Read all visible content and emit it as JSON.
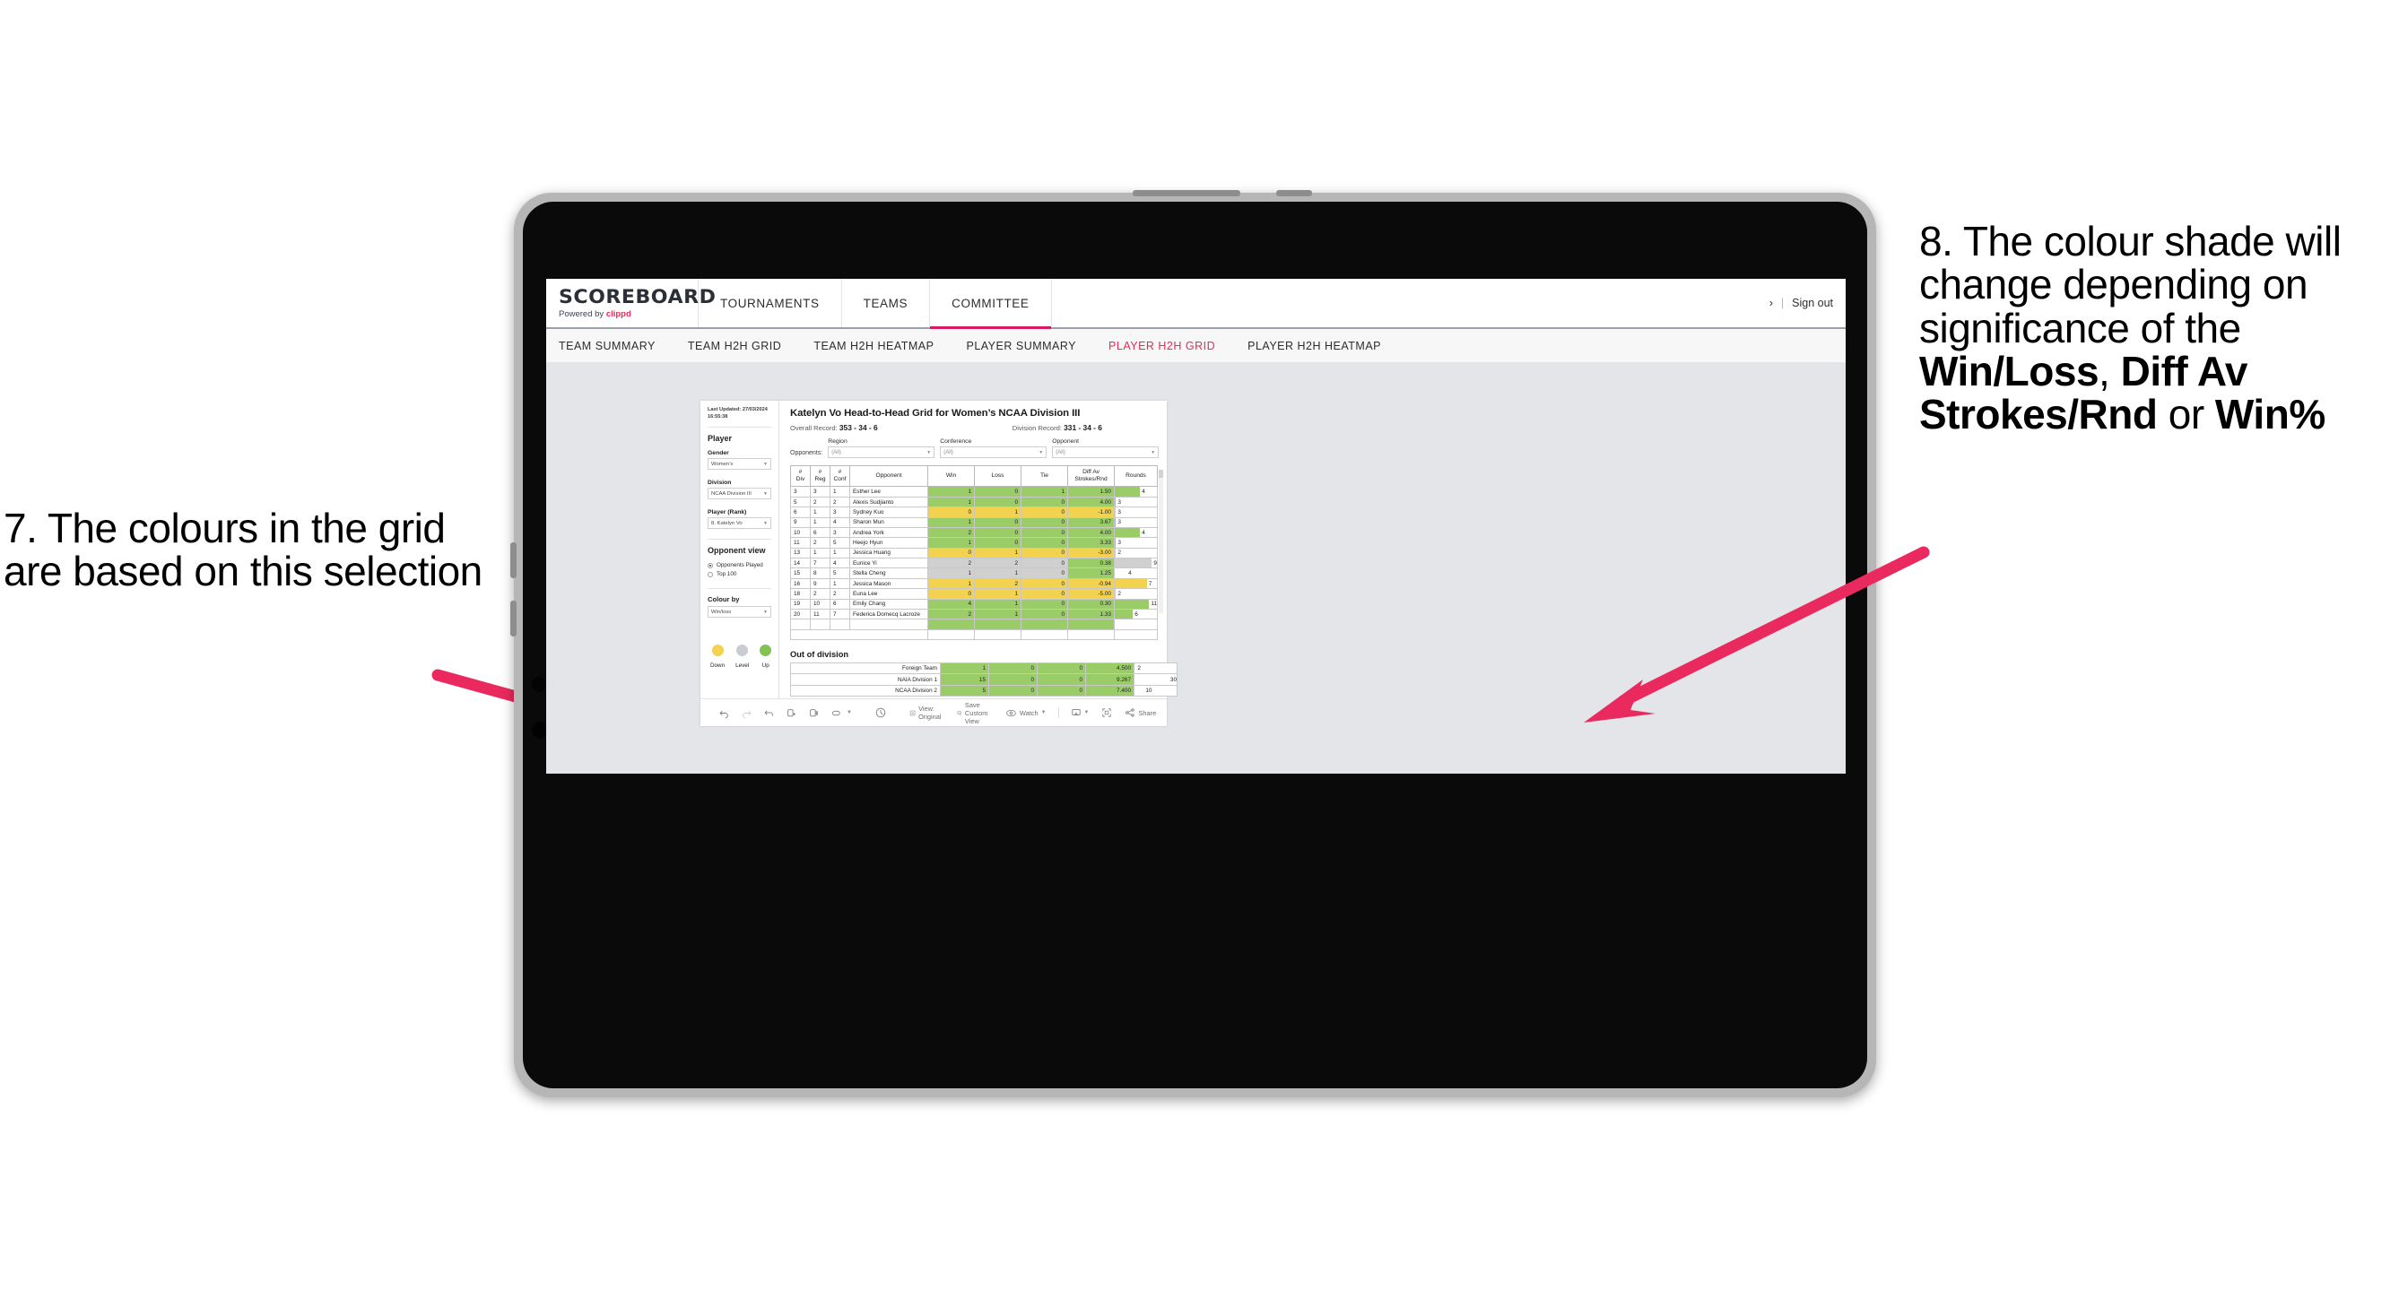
{
  "annotations": {
    "left": {
      "id": "annot-7",
      "text": "7. The colours in the grid are based on this selection"
    },
    "right": {
      "id": "annot-8",
      "lead": "8. The colour shade will change depending on significance of the ",
      "bold1": "Win/Loss",
      "mid1": ", ",
      "bold2": "Diff Av Strokes/Rnd",
      "mid2": " or ",
      "bold3": "Win%",
      "arrow_color": "#ea2a5f"
    }
  },
  "app": {
    "brand": {
      "title": "SCOREBOARD",
      "sub_prefix": "Powered by ",
      "sub_brand": "clippd"
    },
    "nav_tabs": [
      {
        "label": "TOURNAMENTS",
        "active": false
      },
      {
        "label": "TEAMS",
        "active": false
      },
      {
        "label": "COMMITTEE",
        "active": true
      }
    ],
    "top_right": {
      "chevron": "›",
      "sep": "|",
      "sign_out": "Sign out"
    },
    "sub_tabs": [
      {
        "label": "TEAM SUMMARY",
        "active": false
      },
      {
        "label": "TEAM H2H GRID",
        "active": false
      },
      {
        "label": "TEAM H2H HEATMAP",
        "active": false
      },
      {
        "label": "PLAYER SUMMARY",
        "active": false
      },
      {
        "label": "PLAYER H2H GRID",
        "active": true
      },
      {
        "label": "PLAYER H2H HEATMAP",
        "active": false
      }
    ],
    "accent_color": "#e8295a"
  },
  "panel": {
    "last_updated": "Last Updated: 27/03/2024 16:55:38",
    "player_heading": "Player",
    "gender_label": "Gender",
    "gender_value": "Women’s",
    "division_label": "Division",
    "division_value": "NCAA Division III",
    "player_rank_label": "Player (Rank)",
    "player_rank_value": "8. Katelyn Vo",
    "opponent_view_heading": "Opponent view",
    "opponent_view_options": [
      {
        "label": "Opponents Played",
        "selected": true
      },
      {
        "label": "Top 100",
        "selected": false
      }
    ],
    "colour_by_label": "Colour by",
    "colour_by_value": "Win/loss",
    "legend": [
      {
        "label": "Down",
        "color": "#f2d24e"
      },
      {
        "label": "Level",
        "color": "#c9cdd2"
      },
      {
        "label": "Up",
        "color": "#84c255"
      }
    ]
  },
  "viz": {
    "title": "Katelyn Vo Head-to-Head Grid for Women’s NCAA Division III",
    "overall_record_label": "Overall Record: ",
    "overall_record_value": "353 -  34 - 6",
    "division_record_label": "Division Record: ",
    "division_record_value": "331 -  34 - 6",
    "opponents_label": "Opponents:",
    "filters": [
      {
        "name": "Region",
        "value": "(All)"
      },
      {
        "name": "Conference",
        "value": "(All)"
      },
      {
        "name": "Opponent",
        "value": "(All)"
      }
    ],
    "out_of_division_heading": "Out of division"
  },
  "chart_data": {
    "type": "table",
    "title": "Katelyn Vo Head-to-Head Grid for Women’s NCAA Division III",
    "columns": [
      "# Div",
      "# Reg",
      "# Conf",
      "Opponent",
      "Win",
      "Loss",
      "Tie",
      "Diff Av Strokes/Rnd",
      "Rounds"
    ],
    "column_headers_two_line": [
      {
        "l1": "#",
        "l2": "Div"
      },
      {
        "l1": "#",
        "l2": "Reg"
      },
      {
        "l1": "#",
        "l2": "Conf"
      },
      {
        "l1": "Opponent",
        "l2": ""
      },
      {
        "l1": "Win",
        "l2": ""
      },
      {
        "l1": "Loss",
        "l2": ""
      },
      {
        "l1": "Tie",
        "l2": ""
      },
      {
        "l1": "Diff Av",
        "l2": "Strokes/Rnd"
      },
      {
        "l1": "Rounds",
        "l2": ""
      }
    ],
    "colors": {
      "up": "#9acd68",
      "down": "#f2d24e",
      "level": "#d0d0d0",
      "neutral": "#ffffff"
    },
    "rounds_max": 30,
    "rows": [
      {
        "div": "3",
        "reg": "3",
        "conf": "1",
        "opponent": "Esther Lee",
        "win": "1",
        "loss": "0",
        "tie": "1",
        "diff": "1.50",
        "rounds": "4",
        "fill": "up",
        "rounds_fill": "up",
        "rounds_pct": 60
      },
      {
        "div": "5",
        "reg": "2",
        "conf": "2",
        "opponent": "Alexis Sudjianto",
        "win": "1",
        "loss": "0",
        "tie": "0",
        "diff": "4.00",
        "rounds": "3",
        "fill": "up",
        "rounds_fill": "up",
        "rounds_pct": 3
      },
      {
        "div": "6",
        "reg": "1",
        "conf": "3",
        "opponent": "Sydney Kuo",
        "win": "0",
        "loss": "1",
        "tie": "0",
        "diff": "-1.00",
        "fill": "down",
        "rounds": "3",
        "rounds_fill": "down",
        "rounds_pct": 3
      },
      {
        "div": "9",
        "reg": "1",
        "conf": "4",
        "opponent": "Sharon Mun",
        "win": "1",
        "loss": "0",
        "tie": "0",
        "diff": "3.67",
        "rounds": "3",
        "fill": "up",
        "rounds_fill": "up",
        "rounds_pct": 3
      },
      {
        "div": "10",
        "reg": "6",
        "conf": "3",
        "opponent": "Andrea York",
        "win": "2",
        "loss": "0",
        "tie": "0",
        "diff": "4.00",
        "rounds": "4",
        "fill": "up",
        "rounds_fill": "up",
        "rounds_pct": 60
      },
      {
        "div": "11",
        "reg": "2",
        "conf": "5",
        "opponent": "Heejo Hyun",
        "win": "1",
        "loss": "0",
        "tie": "0",
        "diff": "3.33",
        "rounds": "3",
        "fill": "up",
        "rounds_fill": "up",
        "rounds_pct": 3
      },
      {
        "div": "13",
        "reg": "1",
        "conf": "1",
        "opponent": "Jessica Huang",
        "win": "0",
        "loss": "1",
        "tie": "0",
        "diff": "-3.00",
        "rounds": "2",
        "fill": "down",
        "rounds_fill": "down",
        "rounds_pct": 3
      },
      {
        "div": "14",
        "reg": "7",
        "conf": "4",
        "opponent": "Eunice Yi",
        "win": "2",
        "loss": "2",
        "tie": "0",
        "diff": "0.38",
        "rounds": "9",
        "fill": "level",
        "rounds_fill": "level",
        "rounds_pct": 88
      },
      {
        "div": "15",
        "reg": "8",
        "conf": "5",
        "opponent": "Stella Cheng",
        "win": "1",
        "loss": "1",
        "tie": "0",
        "diff": "1.25",
        "rounds": "4",
        "fill": "level",
        "rounds_fill": "white",
        "rounds_pct": 28
      },
      {
        "div": "16",
        "reg": "9",
        "conf": "1",
        "opponent": "Jessica Mason",
        "win": "1",
        "loss": "2",
        "tie": "0",
        "diff": "-0.94",
        "rounds": "7",
        "fill": "down",
        "rounds_fill": "down",
        "rounds_pct": 76
      },
      {
        "div": "18",
        "reg": "2",
        "conf": "2",
        "opponent": "Euna Lee",
        "win": "0",
        "loss": "1",
        "tie": "0",
        "diff": "-5.00",
        "rounds": "2",
        "fill": "down",
        "rounds_fill": "down",
        "rounds_pct": 3
      },
      {
        "div": "19",
        "reg": "10",
        "conf": "6",
        "opponent": "Emily Chang",
        "win": "4",
        "loss": "1",
        "tie": "0",
        "diff": "0.30",
        "rounds": "11",
        "fill": "up",
        "rounds_fill": "up",
        "rounds_pct": 90
      },
      {
        "div": "20",
        "reg": "11",
        "conf": "7",
        "opponent": "Federica Domecq Lacroze",
        "win": "2",
        "loss": "1",
        "tie": "0",
        "diff": "1.33",
        "rounds": "6",
        "fill": "up",
        "rounds_fill": "up",
        "rounds_pct": 43
      }
    ],
    "out_of_division": {
      "heading": "Out of division",
      "rows": [
        {
          "name": "Foreign Team",
          "win": "1",
          "loss": "0",
          "tie": "0",
          "diff": "4.500",
          "rounds": "2",
          "fill": "up",
          "rounds_fill": "white",
          "rounds_pct": 3
        },
        {
          "name": "NAIA Division 1",
          "win": "15",
          "loss": "0",
          "tie": "0",
          "diff": "9.267",
          "rounds": "30",
          "fill": "up",
          "rounds_fill": "up",
          "rounds_pct": 90
        },
        {
          "name": "NCAA Division 2",
          "win": "5",
          "loss": "0",
          "tie": "0",
          "diff": "7.400",
          "rounds": "10",
          "fill": "up",
          "rounds_fill": "up",
          "rounds_pct": 22
        }
      ]
    }
  },
  "toolbar": {
    "items": [
      {
        "name": "undo",
        "label": ""
      },
      {
        "name": "redo",
        "label": ""
      },
      {
        "name": "revert",
        "label": ""
      },
      {
        "name": "refresh",
        "label": ""
      },
      {
        "name": "pause",
        "label": ""
      },
      {
        "name": "highlight",
        "label": ""
      }
    ],
    "view_label": "View: Original",
    "save_custom_view_label": "Save Custom View",
    "watch_label": "Watch",
    "share_label": "Share"
  }
}
